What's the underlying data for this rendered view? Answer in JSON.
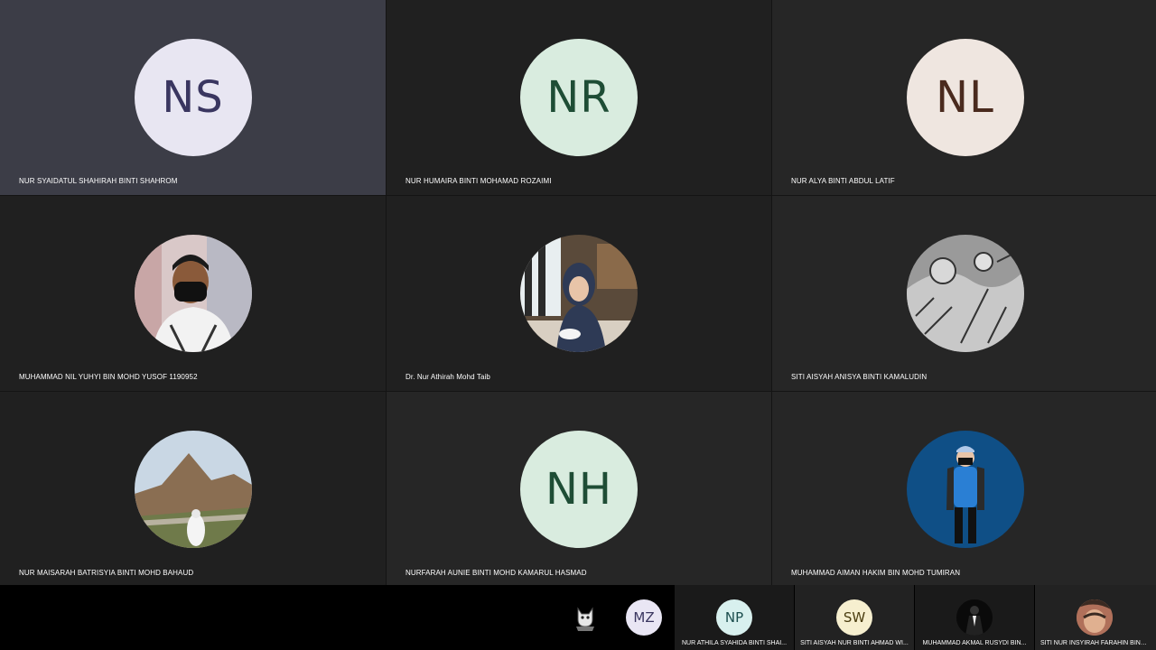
{
  "participants": [
    {
      "name": "NUR SYAIDATUL SHAHIRAH BINTI SHAHROM",
      "initials": "NS",
      "avatar_bg": "#e8e6f2",
      "initials_color": "#3a3660",
      "avatar_type": "initials",
      "active": true
    },
    {
      "name": "NUR HUMAIRA BINTI MOHAMAD ROZAIMI",
      "initials": "NR",
      "avatar_bg": "#d9ecdf",
      "initials_color": "#1e4d35",
      "avatar_type": "initials"
    },
    {
      "name": "NUR ALYA BINTI ABDUL LATIF",
      "initials": "NL",
      "avatar_bg": "#efe6e0",
      "initials_color": "#4a2a1e",
      "avatar_type": "initials"
    },
    {
      "name": "MUHAMMAD NIL YUHYI BIN MOHD YUSOF 1190952",
      "avatar_type": "photo",
      "photo_icon": "person-mask-photo"
    },
    {
      "name": "Dr. Nur Athirah Mohd Taib",
      "avatar_type": "photo",
      "photo_icon": "person-hijab-photo"
    },
    {
      "name": "SITI AISYAH ANISYA BINTI KAMALUDIN",
      "avatar_type": "photo",
      "photo_icon": "sketch-photo"
    },
    {
      "name": "NUR MAISARAH BATRISYIA BINTI MOHD BAHAUD",
      "avatar_type": "photo",
      "photo_icon": "mountain-photo"
    },
    {
      "name": "NURFARAH AUNIE BINTI MOHD KAMARUL HASMAD",
      "initials": "NH",
      "avatar_bg": "#d9ecdf",
      "initials_color": "#1e4d35",
      "avatar_type": "initials"
    },
    {
      "name": "MUHAMMAD AIMAN HAKIM BIN MOHD TUMIRAN",
      "avatar_type": "photo",
      "photo_icon": "blue-figure-photo"
    }
  ],
  "strip": {
    "self_icon": "cat-icon",
    "mz_initials": "MZ",
    "mini": [
      {
        "name": "NUR ATHILA SYAHIDA BINTI SHAI...",
        "initials": "NP",
        "avatar_bg": "#d8f0ee",
        "initials_color": "#1c4e4e"
      },
      {
        "name": "SITI AISYAH NUR BINTI AHMAD WI...",
        "initials": "SW",
        "avatar_bg": "#f6efcf",
        "initials_color": "#4a3d10"
      },
      {
        "name": "MUHAMMAD AKMAL RUSYDI BIN...",
        "initials": "",
        "avatar_type": "photo",
        "photo_icon": "suit-photo"
      },
      {
        "name": "SITI NUR INSYIRAH FARAHIN BINTI...",
        "initials": "",
        "avatar_type": "photo",
        "photo_icon": "face-photo"
      }
    ]
  }
}
